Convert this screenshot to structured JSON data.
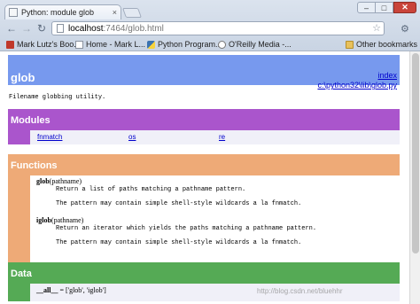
{
  "browser": {
    "tab_title": "Python: module glob",
    "tab_close": "×",
    "window_controls": {
      "minimize": "–",
      "maximize": "□",
      "close": "✕"
    },
    "url_host": "localhost",
    "url_path": ":7464/glob.html",
    "bookmarks": [
      {
        "label": "Mark Lutz's Boo...",
        "icon": "bookmark-favicon"
      },
      {
        "label": "Home - Mark L...",
        "icon": "page-favicon"
      },
      {
        "label": "Python Program...",
        "icon": "python-favicon"
      },
      {
        "label": "O'Reilly Media -...",
        "icon": "oreilly-favicon"
      }
    ],
    "bookmarks_separator": "»",
    "other_bookmarks": "Other bookmarks"
  },
  "page": {
    "title": "glob",
    "index_link": "index",
    "file_link": "c:\\python32\\lib\\glob.py",
    "module_doc": "Filename globbing utility.",
    "modules_heading": "Modules",
    "modules": [
      "fnmatch",
      "os",
      "re"
    ],
    "functions_heading": "Functions",
    "functions": [
      {
        "name": "glob",
        "args": "(pathname)",
        "doc1": "Return a list of paths matching a pathname pattern.",
        "doc2": "The pattern may contain simple shell-style wildcards a la fnmatch."
      },
      {
        "name": "iglob",
        "args": "(pathname)",
        "doc1": "Return an iterator which yields the paths matching a pathname pattern.",
        "doc2": "The pattern may contain simple shell-style wildcards a la fnmatch."
      }
    ],
    "data_heading": "Data",
    "data_name": "__all__",
    "data_value": " = ['glob', 'iglob']"
  },
  "watermark": "http://blog.csdn.net/bluehhr",
  "colors": {
    "heading": "#7799ee",
    "modules": "#aa55cc",
    "functions": "#eeaa77",
    "data": "#55aa55",
    "link": "#0000cc"
  }
}
